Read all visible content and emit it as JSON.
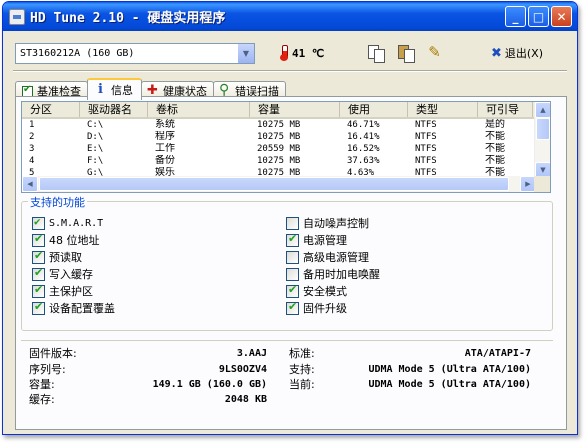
{
  "window": {
    "title": "HD Tune 2.10 - 硬盘实用程序"
  },
  "toolbar": {
    "drive": "ST3160212A (160 GB)",
    "temperature": "41 ℃",
    "exit_label": "退出(X)"
  },
  "tabs": [
    {
      "label": "基准检查",
      "icon": "checkmark-icon"
    },
    {
      "label": "信息",
      "icon": "info-icon",
      "active": true
    },
    {
      "label": "健康状态",
      "icon": "health-cross-icon"
    },
    {
      "label": "错误扫描",
      "icon": "magnifier-icon"
    }
  ],
  "partitions": {
    "headers": [
      "分区",
      "驱动器名",
      "卷标",
      "容量",
      "使用",
      "类型",
      "可引导"
    ],
    "rows": [
      [
        "1",
        "C:\\",
        "系统",
        "10275 MB",
        "46.71%",
        "NTFS",
        "是的"
      ],
      [
        "2",
        "D:\\",
        "程序",
        "10275 MB",
        "16.41%",
        "NTFS",
        "不能"
      ],
      [
        "3",
        "E:\\",
        "工作",
        "20559 MB",
        "16.52%",
        "NTFS",
        "不能"
      ],
      [
        "4",
        "F:\\",
        "备份",
        "10275 MB",
        "37.63%",
        "NTFS",
        "不能"
      ],
      [
        "5",
        "G:\\",
        "娱乐",
        "10275 MB",
        "4.63%",
        "NTFS",
        "不能"
      ]
    ]
  },
  "features": {
    "legend": "支持的功能",
    "left": [
      {
        "label": "S.M.A.R.T",
        "checked": true
      },
      {
        "label": "48 位地址",
        "checked": true
      },
      {
        "label": "预读取",
        "checked": true
      },
      {
        "label": "写入缓存",
        "checked": true
      },
      {
        "label": "主保护区",
        "checked": true
      },
      {
        "label": "设备配置覆盖",
        "checked": true
      }
    ],
    "right": [
      {
        "label": "自动噪声控制",
        "checked": false
      },
      {
        "label": "电源管理",
        "checked": true
      },
      {
        "label": "高级电源管理",
        "checked": false
      },
      {
        "label": "备用时加电唤醒",
        "checked": false
      },
      {
        "label": "安全模式",
        "checked": true
      },
      {
        "label": "固件升级",
        "checked": true
      }
    ]
  },
  "info": {
    "firmware_label": "固件版本:",
    "firmware": "3.AAJ",
    "serial_label": "序列号:",
    "serial": "9LS0OZV4",
    "capacity_label": "容量:",
    "capacity": "149.1 GB (160.0 GB)",
    "cache_label": "缓存:",
    "cache": "2048 KB",
    "standard_label": "标准:",
    "standard": "ATA/ATAPI-7",
    "supported_label": "支持:",
    "supported": "UDMA Mode 5 (Ultra ATA/100)",
    "current_label": "当前:",
    "current": "UDMA Mode 5 (Ultra ATA/100)"
  }
}
